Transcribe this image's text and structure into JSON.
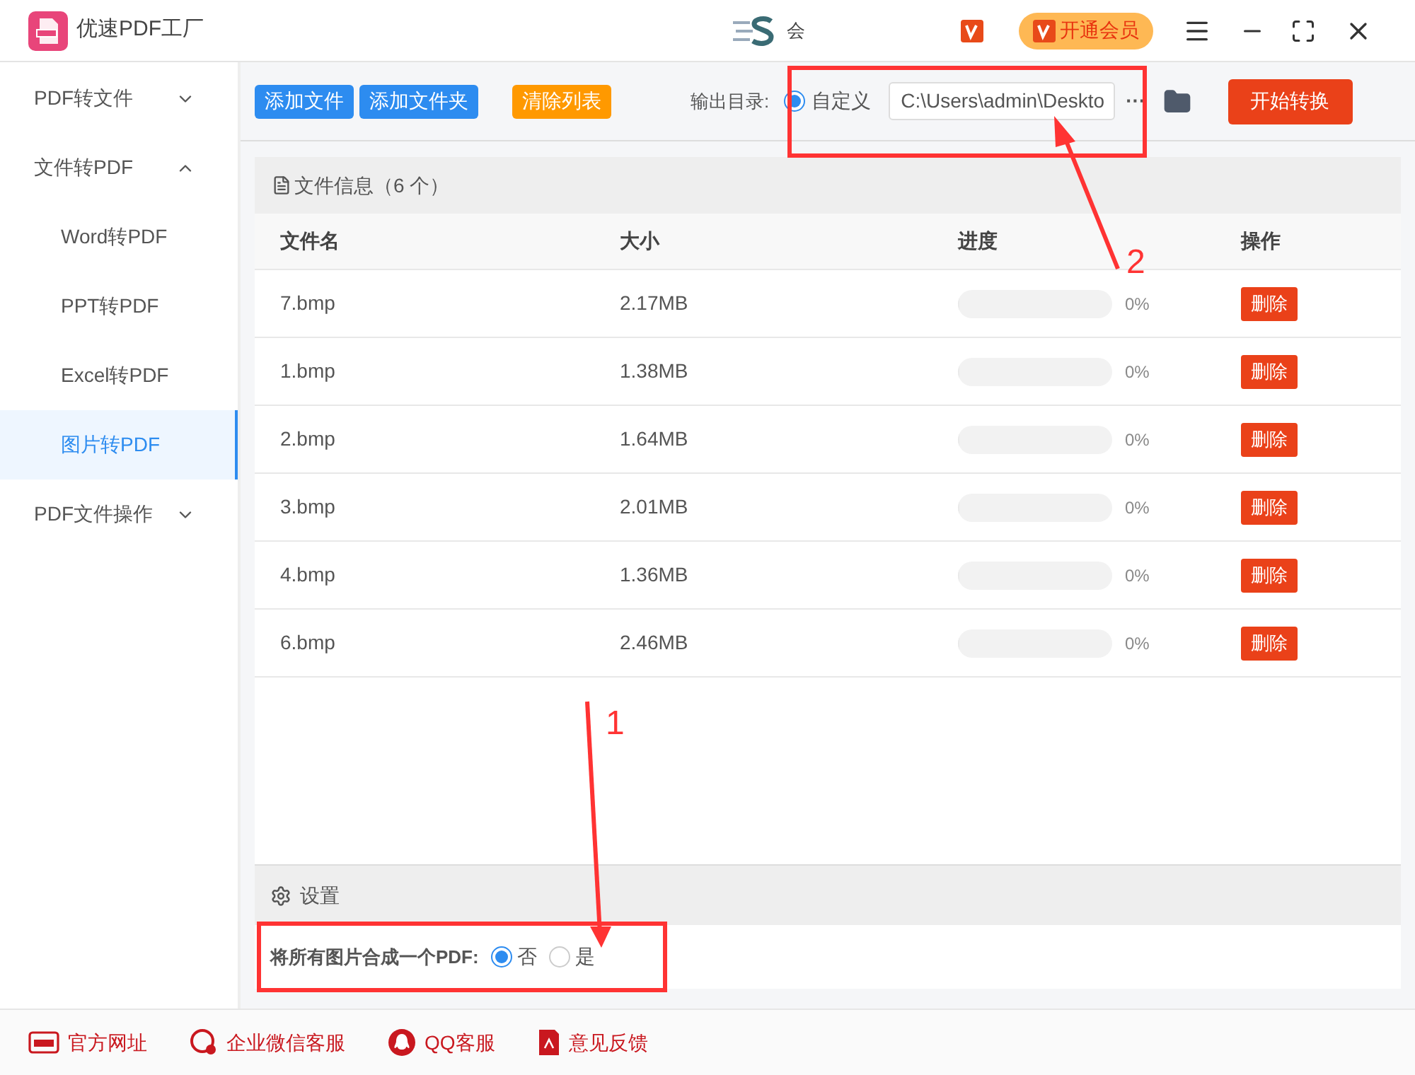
{
  "window": {
    "title": "优速PDF工厂",
    "center_text": "会",
    "vip_button": "开通会员"
  },
  "sidebar": {
    "items": [
      {
        "label": "PDF转文件",
        "expanded": false
      },
      {
        "label": "文件转PDF",
        "expanded": true,
        "children": [
          {
            "label": "Word转PDF",
            "selected": false
          },
          {
            "label": "PPT转PDF",
            "selected": false
          },
          {
            "label": "Excel转PDF",
            "selected": false
          },
          {
            "label": "图片转PDF",
            "selected": true
          }
        ]
      },
      {
        "label": "PDF文件操作",
        "expanded": false
      }
    ]
  },
  "toolbar": {
    "add_file": "添加文件",
    "add_folder": "添加文件夹",
    "clear": "清除列表",
    "output_label": "输出目录:",
    "custom_option": {
      "label": "自定义",
      "selected": true
    },
    "output_path": "C:\\Users\\admin\\Deskto",
    "more": "···",
    "start": "开始转换"
  },
  "file_panel": {
    "title": "文件信息（6 个）",
    "columns": [
      "文件名",
      "大小",
      "进度",
      "操作"
    ],
    "rows": [
      {
        "name": "7.bmp",
        "size": "2.17MB",
        "level": 0,
        "percent": "0%",
        "action": "删除"
      },
      {
        "name": "1.bmp",
        "size": "1.38MB",
        "level": 0,
        "percent": "0%",
        "action": "删除"
      },
      {
        "name": "2.bmp",
        "size": "1.64MB",
        "level": 0,
        "percent": "0%",
        "action": "删除"
      },
      {
        "name": "3.bmp",
        "size": "2.01MB",
        "level": 0,
        "percent": "0%",
        "action": "删除"
      },
      {
        "name": "4.bmp",
        "size": "1.36MB",
        "level": 0,
        "percent": "0%",
        "action": "删除"
      },
      {
        "name": "6.bmp",
        "size": "2.46MB",
        "level": 0,
        "percent": "0%",
        "action": "删除"
      }
    ]
  },
  "settings": {
    "title": "设置",
    "merge_label": "将所有图片合成一个PDF:",
    "options": [
      {
        "label": "否",
        "selected": true
      },
      {
        "label": "是",
        "selected": false
      }
    ]
  },
  "footer": [
    {
      "kind": "web",
      "label": "官方网址"
    },
    {
      "kind": "wechat",
      "label": "企业微信客服"
    },
    {
      "kind": "qq",
      "label": "QQ客服"
    },
    {
      "kind": "feedback",
      "label": "意见反馈"
    }
  ],
  "annotations": [
    {
      "label": "2"
    },
    {
      "label": "1"
    }
  ]
}
